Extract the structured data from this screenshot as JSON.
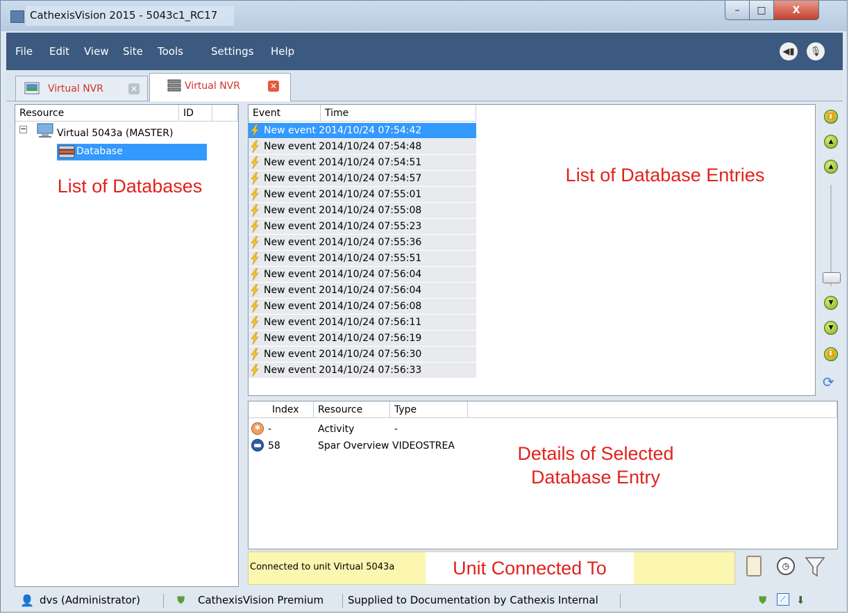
{
  "window": {
    "title": "CathexisVision 2015 - 5043c1_RC17",
    "controls": {
      "minimize": "–",
      "maximize": "□",
      "close": "X"
    }
  },
  "menu": {
    "items": [
      "File",
      "Edit",
      "View",
      "Site",
      "Tools",
      "Settings",
      "Help"
    ]
  },
  "tabs": [
    {
      "label": "Virtual NVR",
      "icon": "video-panel-icon",
      "active": false
    },
    {
      "label": "Virtual NVR",
      "icon": "database-icon",
      "active": true
    }
  ],
  "resource_tree": {
    "headers": {
      "resource": "Resource",
      "id": "ID"
    },
    "root": {
      "label": "Virtual 5043a (MASTER)",
      "icon": "computer-icon"
    },
    "child": {
      "label": "Database",
      "icon": "database-icon",
      "selected": true
    }
  },
  "event_list": {
    "headers": {
      "event": "Event",
      "time": "Time"
    },
    "rows": [
      "New event 2014/10/24 07:54:42",
      "New event 2014/10/24 07:54:48",
      "New event 2014/10/24 07:54:51",
      "New event 2014/10/24 07:54:57",
      "New event 2014/10/24 07:55:01",
      "New event 2014/10/24 07:55:08",
      "New event 2014/10/24 07:55:23",
      "New event 2014/10/24 07:55:36",
      "New event 2014/10/24 07:55:51",
      "New event 2014/10/24 07:56:04",
      "New event 2014/10/24 07:56:04",
      "New event 2014/10/24 07:56:08",
      "New event 2014/10/24 07:56:11",
      "New event 2014/10/24 07:56:19",
      "New event 2014/10/24 07:56:30",
      "New event 2014/10/24 07:56:33"
    ],
    "selected_index": 0
  },
  "details": {
    "headers": {
      "index": "Index",
      "resource": "Resource",
      "type": "Type"
    },
    "rows": [
      {
        "index": "-",
        "resource": "Activity",
        "type": "-",
        "icon": "activity-icon"
      },
      {
        "index": "58",
        "resource": "Spar Overview",
        "type": "VIDEOSTREA",
        "icon": "camera-icon"
      }
    ]
  },
  "status_line": "Connected to unit Virtual 5043a",
  "annotations": {
    "databases": "List of Databases",
    "entries": "List of Database Entries",
    "details": "Details of Selected Database Entry",
    "unit": "Unit Connected To"
  },
  "statusbar": {
    "user": "dvs (Administrator)",
    "license": "CathexisVision Premium",
    "supplied": "Supplied to Documentation by Cathexis Internal"
  },
  "colors": {
    "menubar": "#3c5a80",
    "annotation": "#e2211c",
    "selection": "#3399ff",
    "status_bg": "#fbf6b0"
  }
}
